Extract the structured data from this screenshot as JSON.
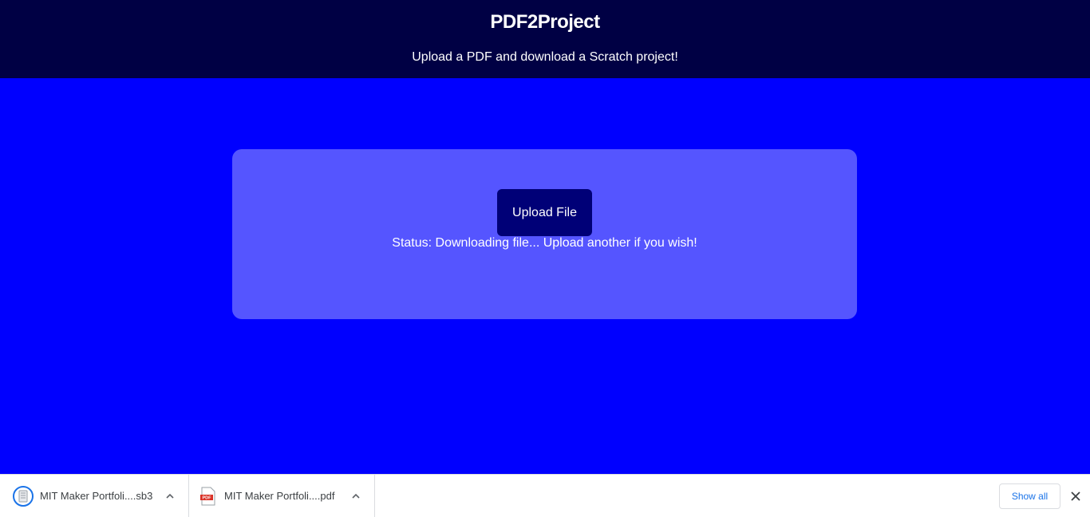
{
  "header": {
    "title": "PDF2Project",
    "subtitle": "Upload a PDF and download a Scratch project!"
  },
  "main": {
    "upload_button_label": "Upload File",
    "status_text": "Status: Downloading file... Upload another if you wish!"
  },
  "download_shelf": {
    "items": [
      {
        "name": "MIT Maker Portfoli....sb3",
        "icon": "scratch-file-icon"
      },
      {
        "name": "MIT Maker Portfoli....pdf",
        "icon": "pdf-file-icon"
      }
    ],
    "show_all_label": "Show all",
    "close_icon": "close-icon"
  },
  "colors": {
    "page_background": "#0000ff",
    "header_background": "#000044",
    "card_background": "#5555ff",
    "button_background": "#000077",
    "text": "#ffffff",
    "link_blue": "#1a73e8"
  }
}
